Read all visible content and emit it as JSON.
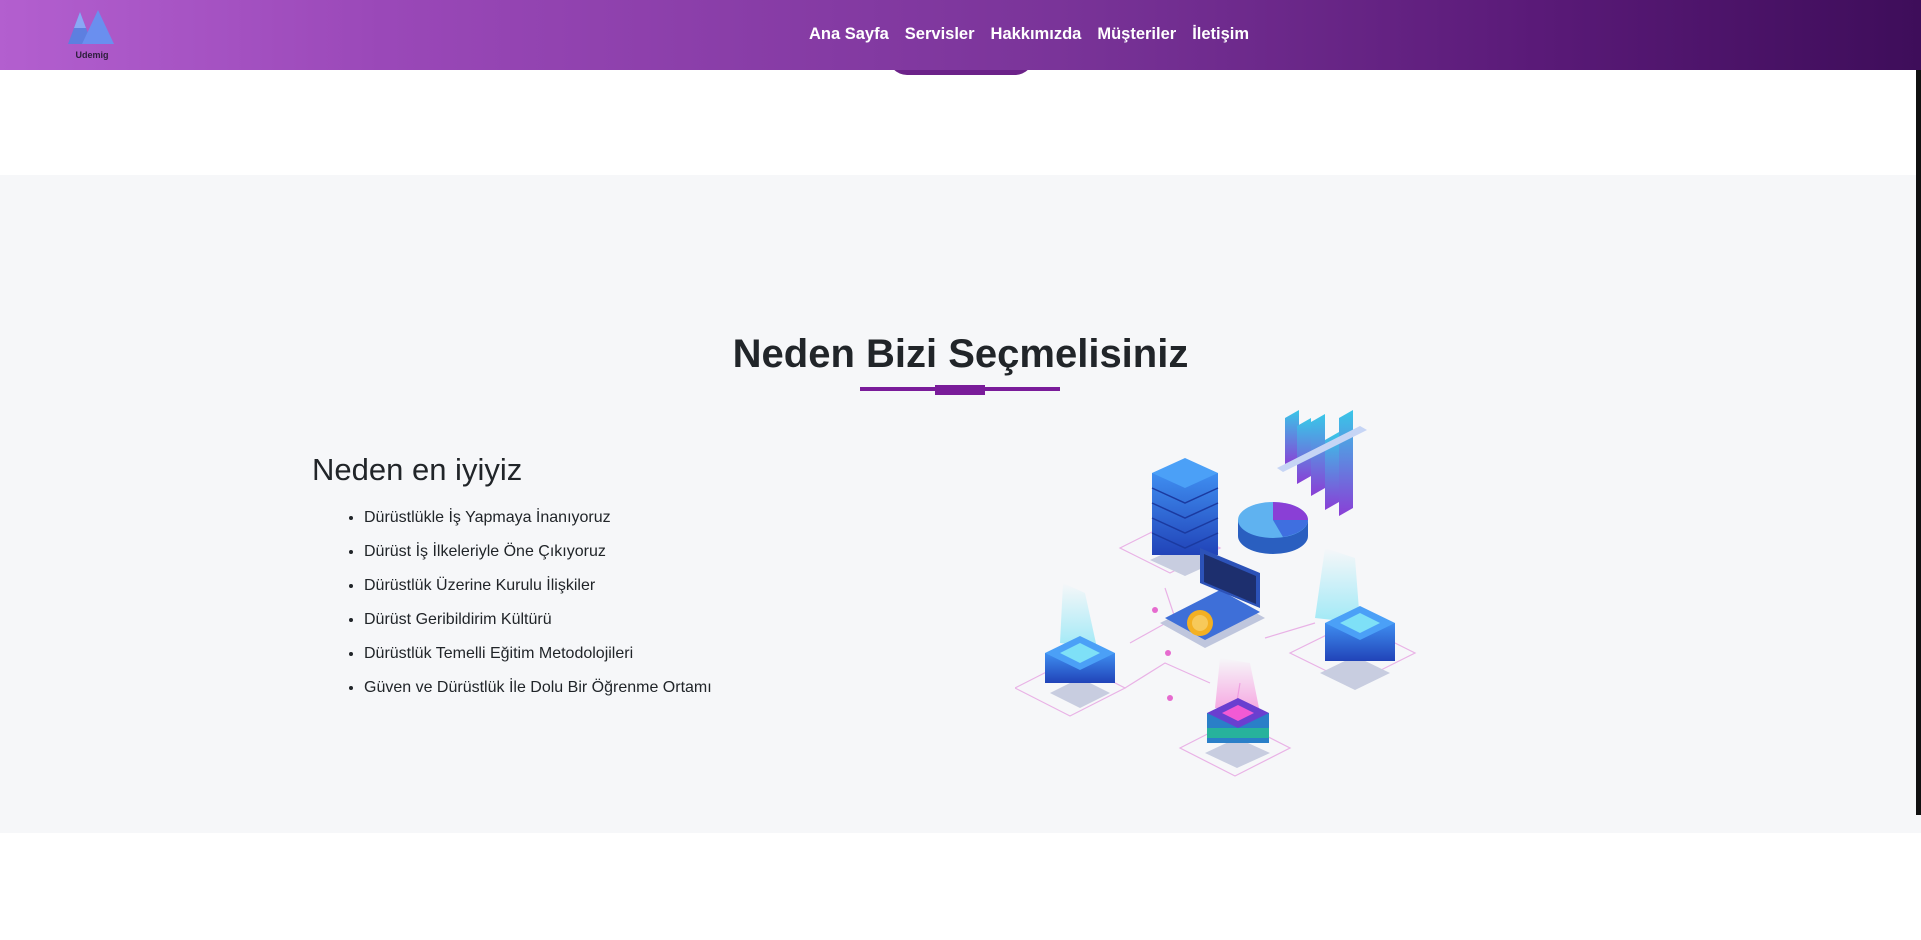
{
  "brand": {
    "name": "Udemig"
  },
  "nav": {
    "items": [
      "Ana Sayfa",
      "Servisler",
      "Hakkımızda",
      "Müşteriler",
      "İletişim"
    ]
  },
  "why_us": {
    "title": "Neden Bizi Seçmelisiniz",
    "subheading": "Neden en iyiyiz",
    "features": [
      "Dürüstlükle İş Yapmaya İnanıyoruz",
      "Dürüst İş İlkeleriyle Öne Çıkıyoruz",
      "Dürüstlük Üzerine Kurulu İlişkiler",
      "Dürüst Geribildirim Kültürü",
      "Dürüstlük Temelli Eğitim Metodolojileri",
      "Güven ve Dürüstlük İle Dolu Bir Öğrenme Ortamı"
    ]
  },
  "colors": {
    "accent": "#7a1c9a",
    "nav_gradient_start": "#b35fcf",
    "nav_gradient_end": "#3e0d5a",
    "section_bg": "#f6f7f9"
  }
}
